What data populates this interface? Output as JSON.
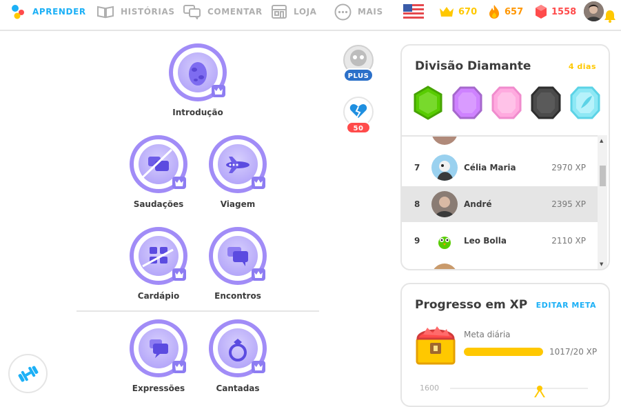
{
  "nav": {
    "items": [
      {
        "label": "APRENDER",
        "icon": "duolingo-logo-icon",
        "active": true
      },
      {
        "label": "HISTÓRIAS",
        "icon": "book-icon",
        "active": false
      },
      {
        "label": "COMENTAR",
        "icon": "chat-bubbles-icon",
        "active": false
      },
      {
        "label": "LOJA",
        "icon": "shop-icon",
        "active": false
      },
      {
        "label": "MAIS",
        "icon": "more-dots-icon",
        "active": false
      }
    ],
    "language_flag": "us-flag-icon",
    "crowns": "670",
    "streak": "657",
    "gems": "1558",
    "avatar_icon": "avatar",
    "bell_icon": "bell-icon"
  },
  "path": {
    "skills": [
      {
        "name": "Introdução",
        "icon": "egg-icon"
      },
      {
        "name": "Saudações",
        "icon": "chat-bubbles-icon"
      },
      {
        "name": "Viagem",
        "icon": "airplane-icon"
      },
      {
        "name": "Cardápio",
        "icon": "menu-grid-icon"
      },
      {
        "name": "Encontros",
        "icon": "chat-bubbles-icon"
      },
      {
        "name": "Expressões",
        "icon": "chat-bubbles-icon"
      },
      {
        "name": "Cantadas",
        "icon": "ring-icon"
      }
    ],
    "plus_label": "PLUS",
    "health_label": "50",
    "practice_icon": "dumbbell-icon"
  },
  "league": {
    "title": "Divisão Diamante",
    "days_left": "4 dias",
    "rows": [
      {
        "rank": "7",
        "name": "Célia Maria",
        "xp": "2970 XP"
      },
      {
        "rank": "8",
        "name": "André",
        "xp": "2395 XP"
      },
      {
        "rank": "9",
        "name": "Leo Bolla",
        "xp": "2110 XP"
      }
    ]
  },
  "xp_progress": {
    "title": "Progresso em XP",
    "edit_link": "EDITAR META",
    "goal_label": "Meta diária",
    "goal_value": "1017/20 XP",
    "goal_fraction": 1.0,
    "axis_tick": "1600"
  },
  "colors": {
    "accent_blue": "#1cb0f6",
    "crown_gold": "#ffc800",
    "streak_orange": "#ff9600",
    "gem_red": "#ff4b4b",
    "skill_purple": "#a18cf7",
    "plus_blue": "#2b70c9"
  }
}
